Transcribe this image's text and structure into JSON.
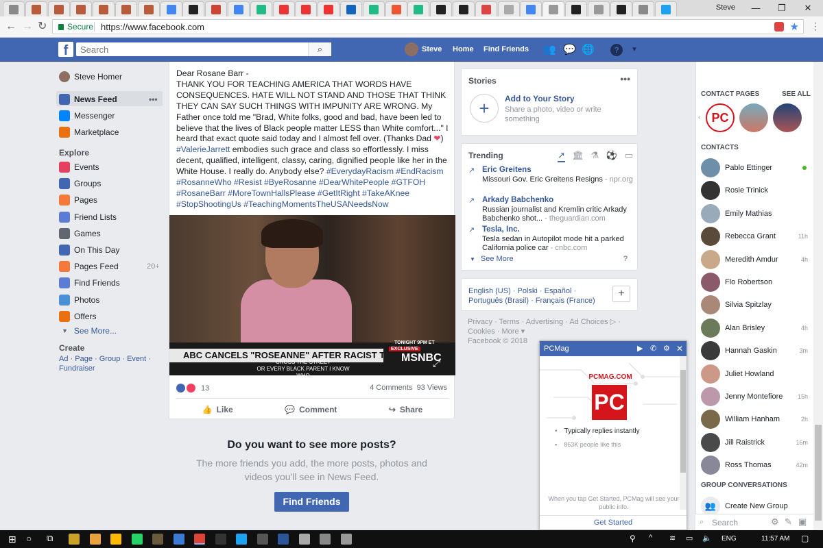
{
  "browser": {
    "user": "Steve",
    "secure_label": "Secure",
    "url": "https://www.facebook.com",
    "tab_colors": [
      "#8a8a8a",
      "#b85c3c",
      "#b85c3c",
      "#b85c3c",
      "#b85c3c",
      "#b85c3c",
      "#b85c3c",
      "#4285f4",
      "#222",
      "#c43",
      "#4285f4",
      "#2b8",
      "#e33",
      "#e33",
      "#e33",
      "#1565c0",
      "#2b8",
      "#e53",
      "#2b8",
      "#222",
      "#222",
      "#d44",
      "#aaa",
      "#4285f4",
      "#999",
      "#222",
      "#999",
      "#222",
      "#8a8a8a",
      "#1da1f2"
    ],
    "window_controls": [
      "—",
      "❐",
      "✕"
    ]
  },
  "header": {
    "logo": "f",
    "search_placeholder": "Search",
    "user_name": "Steve",
    "home": "Home",
    "find_friends": "Find Friends"
  },
  "left_nav": {
    "user": "Steve Homer",
    "main_items": [
      {
        "label": "News Feed",
        "color": "#4267b2"
      },
      {
        "label": "Messenger",
        "color": "#0084ff"
      },
      {
        "label": "Marketplace",
        "color": "#e9710f"
      }
    ],
    "explore_title": "Explore",
    "explore_items": [
      {
        "label": "Events",
        "color": "#e4405f",
        "count": ""
      },
      {
        "label": "Groups",
        "color": "#4267b2",
        "count": ""
      },
      {
        "label": "Pages",
        "color": "#f5793a",
        "count": ""
      },
      {
        "label": "Friend Lists",
        "color": "#5b7bd5",
        "count": ""
      },
      {
        "label": "Games",
        "color": "#606770",
        "count": ""
      },
      {
        "label": "On This Day",
        "color": "#4267b2",
        "count": ""
      },
      {
        "label": "Pages Feed",
        "color": "#f5793a",
        "count": "20+"
      },
      {
        "label": "Find Friends",
        "color": "#5b7bd5",
        "count": ""
      },
      {
        "label": "Photos",
        "color": "#4a90d9",
        "count": ""
      },
      {
        "label": "Offers",
        "color": "#e9710f",
        "count": ""
      }
    ],
    "see_more": "See More...",
    "create_title": "Create",
    "create_links": [
      "Ad",
      "Page",
      "Group",
      "Event",
      "Fundraiser"
    ]
  },
  "post": {
    "salutation": "Dear Rosane Barr -",
    "body": "THANK YOU FOR TEACHING AMERICA THAT WORDS HAVE CONSEQUENCES. HATE WILL NOT STAND AND THOSE THAT THINK THEY CAN SAY SUCH THINGS WITH IMPUNITY ARE WRONG. My Father once told me \"Brad, White folks, good and bad, have been led to believe that the lives of Black people matter LESS than White comfort...\" I heard that exact quote said today and I almost fell over. (Thanks Dad ",
    "close_paren": ")",
    "hashtag_valerie": "#ValerieJarrett",
    "body2": " embodies such grace and class so effortlessly. I miss decent, qualified, intelligent, classy, caring, dignified people like her in the White House. I really do. Anybody else? ",
    "hashtags": "#EverydayRacism #EndRacism #RosanneWho #Resist #ByeRosanne #DearWhitePeople #GTFOH #RosaneBarr #MoreTownHallsPlease #GetItRight #TakeAKnee #StopShootingUs #TeachingMomentsTheUSANeedsNow",
    "video": {
      "headline": "ABC CANCELS \"ROSEANNE\" AFTER RACIST TWEET",
      "subline1": "CROSS THE STREET",
      "subline2": "OR EVERY BLACK PARENT I KNOW WHO",
      "tonight": "TONIGHT 9PM ET",
      "exclusive": "EXCLUSIVE",
      "network": "MSNBC"
    },
    "reaction_count": "13",
    "comments": "4 Comments",
    "views": "93 Views",
    "like": "Like",
    "comment": "Comment",
    "share": "Share"
  },
  "more_posts": {
    "title": "Do you want to see more posts?",
    "subtitle": "The more friends you add, the more posts, photos and videos you'll see in News Feed.",
    "button": "Find Friends"
  },
  "stories": {
    "title": "Stories",
    "add": "Add to Your Story",
    "desc": "Share a photo, video or write something"
  },
  "trending": {
    "title": "Trending",
    "items": [
      {
        "title": "Eric Greitens",
        "desc": "Missouri Gov. Eric Greitens Resigns",
        "source": "- npr.org"
      },
      {
        "title": "Arkady Babchenko",
        "desc": "Russian journalist and Kremlin critic Arkady Babchenko shot...",
        "source": "- theguardian.com"
      },
      {
        "title": "Tesla, Inc.",
        "desc": "Tesla sedan in Autopilot mode hit a parked California police car",
        "source": "- cnbc.com"
      }
    ],
    "see_more": "See More",
    "help": "?"
  },
  "languages": {
    "line1": "English (US) · Polski · Español ·",
    "line2": "Português (Brasil) · Français (France)",
    "add": "+"
  },
  "footer": {
    "line1": "Privacy · Terms · Advertising · Ad Choices ▷ ·",
    "line2": "Cookies · More ▾",
    "line3": "Facebook © 2018"
  },
  "chat": {
    "title": "PCMag",
    "brand": "PCMAG.COM",
    "logo": "PC",
    "replies": "Typically replies instantly",
    "likes": "863K people like this",
    "notice": "When you tap Get Started, PCMag will see your public info.",
    "cta": "Get Started"
  },
  "sidebar": {
    "contact_pages": "CONTACT PAGES",
    "see_all": "SEE ALL",
    "contacts_title": "CONTACTS",
    "contacts": [
      {
        "name": "Pablo Ettinger",
        "time": "",
        "online": true,
        "color": "#6d8fa8"
      },
      {
        "name": "Rosie Trinick",
        "time": "",
        "online": false,
        "color": "#333"
      },
      {
        "name": "Emily Mathias",
        "time": "",
        "online": false,
        "color": "#9ab"
      },
      {
        "name": "Rebecca Grant",
        "time": "11h",
        "online": false,
        "color": "#5a4a3a"
      },
      {
        "name": "Meredith Amdur",
        "time": "4h",
        "online": false,
        "color": "#c9a98a"
      },
      {
        "name": "Flo Robertson",
        "time": "",
        "online": false,
        "color": "#8a5a6a"
      },
      {
        "name": "Silvia Spitzlay",
        "time": "",
        "online": false,
        "color": "#a87"
      },
      {
        "name": "Alan Brisley",
        "time": "4h",
        "online": false,
        "color": "#6a7a5a"
      },
      {
        "name": "Hannah Gaskin",
        "time": "3m",
        "online": false,
        "color": "#3a3a3a"
      },
      {
        "name": "Juliet Howland",
        "time": "",
        "online": false,
        "color": "#c98"
      },
      {
        "name": "Jenny Montefiore",
        "time": "15h",
        "online": false,
        "color": "#b9a"
      },
      {
        "name": "William Hanham",
        "time": "2h",
        "online": false,
        "color": "#7a6a4a"
      },
      {
        "name": "Jill Raistrick",
        "time": "16m",
        "online": false,
        "color": "#4a4a4a"
      },
      {
        "name": "Ross Thomas",
        "time": "42m",
        "online": false,
        "color": "#889"
      }
    ],
    "group_title": "GROUP CONVERSATIONS",
    "create_group": "Create New Group",
    "search": "Search"
  },
  "taskbar": {
    "lang": "ENG",
    "time": "11:57 AM"
  }
}
